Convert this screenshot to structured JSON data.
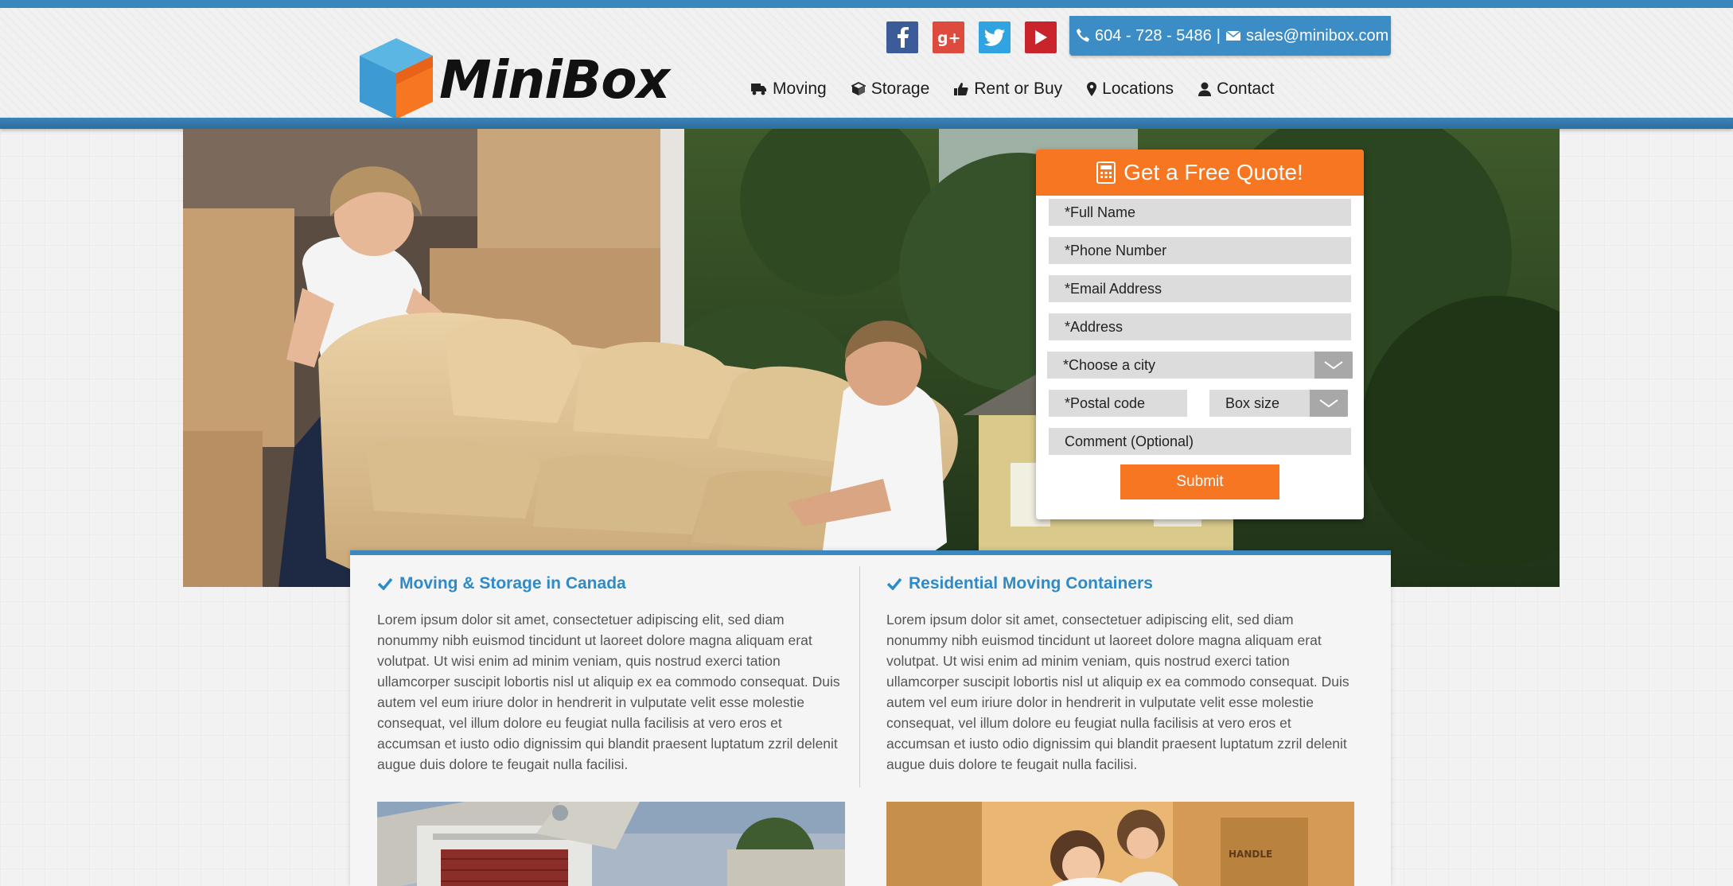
{
  "header": {
    "logo_text": "MiniBox",
    "phone": "604 - 728 - 5486",
    "separator": "|",
    "email": "sales@minibox.com",
    "social": [
      {
        "name": "facebook-icon",
        "glyph": "f"
      },
      {
        "name": "google-plus-icon",
        "glyph": "g+"
      },
      {
        "name": "twitter-icon",
        "glyph": "t"
      },
      {
        "name": "youtube-icon",
        "glyph": "▶"
      }
    ],
    "nav": [
      {
        "label": "Moving",
        "icon": "truck-icon"
      },
      {
        "label": "Storage",
        "icon": "cube-icon"
      },
      {
        "label": "Rent or Buy",
        "icon": "thumbs-up-icon"
      },
      {
        "label": "Locations",
        "icon": "map-marker-icon"
      },
      {
        "label": "Contact",
        "icon": "user-icon"
      }
    ]
  },
  "quote_form": {
    "title": "Get a Free Quote!",
    "full_name_placeholder": "*Full Name",
    "phone_placeholder": "*Phone Number",
    "email_placeholder": "*Email Address",
    "address_placeholder": "*Address",
    "city_select": "*Choose a city",
    "postal_placeholder": "*Postal code",
    "box_size_select": "Box size",
    "comment_placeholder": "Comment (Optional)",
    "submit_label": "Submit"
  },
  "content": {
    "col1_title": "Moving & Storage in Canada",
    "col1_text": "Lorem ipsum dolor sit amet, consectetuer adipiscing elit, sed diam nonummy nibh euismod tincidunt ut laoreet dolore magna aliquam erat volutpat. Ut wisi enim ad minim veniam, quis nostrud exerci tation ullamcorper suscipit lobortis nisl ut aliquip ex ea commodo consequat. Duis autem vel eum iriure dolor in hendrerit in vulputate velit esse molestie consequat, vel illum dolore eu feugiat nulla facilisis at vero eros et accumsan et iusto odio dignissim qui blandit praesent luptatum zzril delenit augue duis dolore te feugait nulla facilisi.",
    "col2_title": "Residential Moving Containers",
    "col2_text": "Lorem ipsum dolor sit amet, consectetuer adipiscing elit, sed diam nonummy nibh euismod tincidunt ut laoreet dolore magna aliquam erat volutpat. Ut wisi enim ad minim veniam, quis nostrud exerci tation ullamcorper suscipit lobortis nisl ut aliquip ex ea commodo consequat. Duis autem vel eum iriure dolor in hendrerit in vulputate velit esse molestie consequat, vel illum dolore eu feugiat nulla facilisis at vero eros et accumsan et iusto odio dignissim qui blandit praesent luptatum zzril delenit augue duis dolore te feugait nulla facilisi."
  },
  "colors": {
    "brand_blue": "#3a87bd",
    "brand_orange": "#f77621",
    "heading_blue": "#2f8ac8"
  }
}
